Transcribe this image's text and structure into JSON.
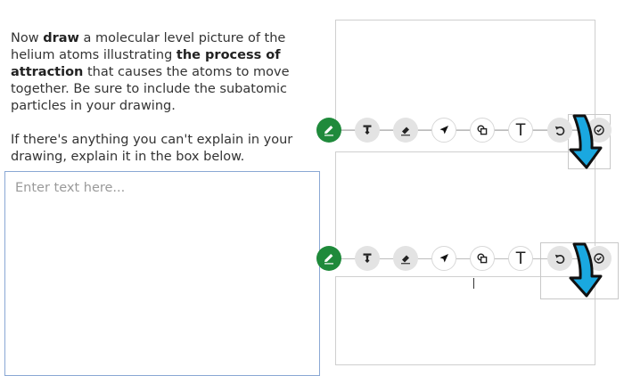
{
  "prompt": {
    "p1_a": "Now ",
    "p1_b": "draw",
    "p1_c": " a molecular level picture of the helium atoms illustrating ",
    "p1_d": "the process of attraction",
    "p1_e": " that causes the atoms to move together. Be sure to include the subatomic particles in your drawing.",
    "p2": "If there's anything you can't explain in your drawing, explain it in the box below."
  },
  "answer": {
    "placeholder": "Enter text here...",
    "value": ""
  },
  "toolbar": {
    "tools": [
      {
        "name": "pencil-tool",
        "icon": "pencil-icon",
        "state": "active"
      },
      {
        "name": "stamp-tool",
        "icon": "stamp-icon",
        "state": "default"
      },
      {
        "name": "eraser-tool",
        "icon": "eraser-icon",
        "state": "default"
      },
      {
        "name": "select-tool",
        "icon": "pointer-arrow-icon",
        "state": "default"
      },
      {
        "name": "shapes-tool",
        "icon": "shapes-icon",
        "state": "default"
      },
      {
        "name": "text-tool",
        "icon": "text-icon",
        "state": "default"
      },
      {
        "name": "undo-tool",
        "icon": "undo-icon",
        "state": "default"
      },
      {
        "name": "done-tool",
        "icon": "checkmark-icon",
        "state": "default"
      }
    ],
    "text_tool_glyph": "T"
  },
  "colors": {
    "active_tool": "#1f8a3b",
    "tool_bg": "#e3e3e3",
    "annotation_arrow": "#1aa8e0",
    "answer_border": "#8aa8d4"
  }
}
